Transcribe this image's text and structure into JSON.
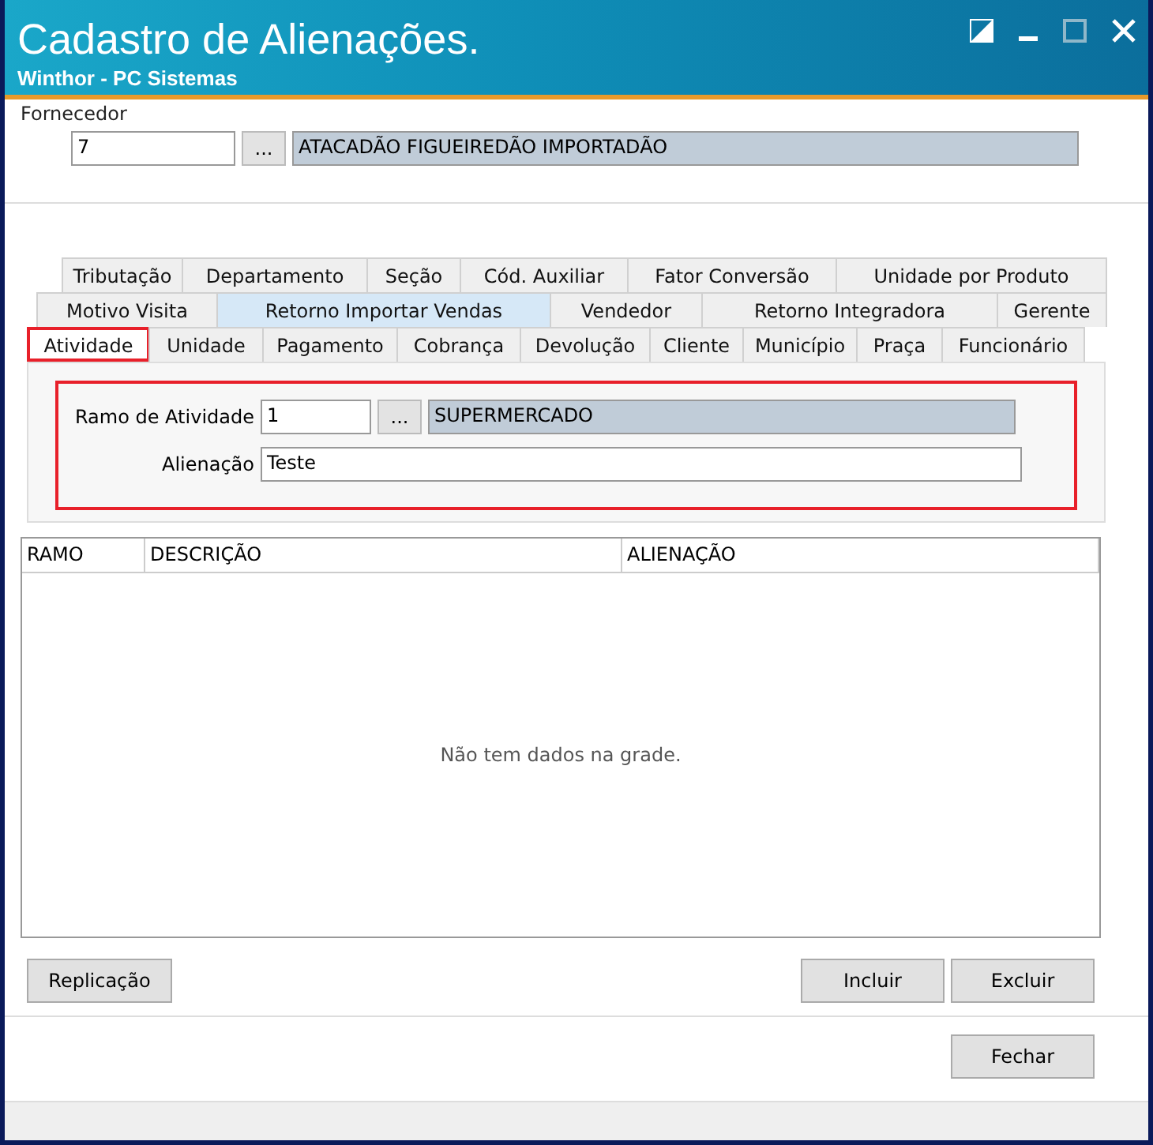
{
  "window": {
    "title": "Cadastro de Alienações.",
    "subtitle": "Winthor - PC Sistemas"
  },
  "fornecedor": {
    "legend": "Fornecedor",
    "code": "7",
    "lookup": "...",
    "name": "ATACADÃO FIGUEIREDÃO IMPORTADÃO"
  },
  "tab_rows": [
    [
      {
        "label": "Tributação",
        "selected": false,
        "highlighted": false,
        "outlined": false
      },
      {
        "label": "Departamento",
        "selected": false,
        "highlighted": false,
        "outlined": false
      },
      {
        "label": "Seção",
        "selected": false,
        "highlighted": false,
        "outlined": false
      },
      {
        "label": "Cód. Auxiliar",
        "selected": false,
        "highlighted": false,
        "outlined": false
      },
      {
        "label": "Fator Conversão",
        "selected": false,
        "highlighted": false,
        "outlined": false
      },
      {
        "label": "Unidade por Produto",
        "selected": false,
        "highlighted": false,
        "outlined": false
      }
    ],
    [
      {
        "label": "Motivo Visita",
        "selected": false,
        "highlighted": false,
        "outlined": false
      },
      {
        "label": "Retorno Importar Vendas",
        "selected": false,
        "highlighted": true,
        "outlined": false
      },
      {
        "label": "Vendedor",
        "selected": false,
        "highlighted": false,
        "outlined": false
      },
      {
        "label": "Retorno Integradora",
        "selected": false,
        "highlighted": false,
        "outlined": false
      },
      {
        "label": "Gerente",
        "selected": false,
        "highlighted": false,
        "outlined": false
      }
    ],
    [
      {
        "label": "Atividade",
        "selected": true,
        "highlighted": false,
        "outlined": true
      },
      {
        "label": "Unidade",
        "selected": false,
        "highlighted": false,
        "outlined": false
      },
      {
        "label": "Pagamento",
        "selected": false,
        "highlighted": false,
        "outlined": false
      },
      {
        "label": "Cobrança",
        "selected": false,
        "highlighted": false,
        "outlined": false
      },
      {
        "label": "Devolução",
        "selected": false,
        "highlighted": false,
        "outlined": false
      },
      {
        "label": "Cliente",
        "selected": false,
        "highlighted": false,
        "outlined": false
      },
      {
        "label": "Município",
        "selected": false,
        "highlighted": false,
        "outlined": false
      },
      {
        "label": "Praça",
        "selected": false,
        "highlighted": false,
        "outlined": false
      },
      {
        "label": "Funcionário",
        "selected": false,
        "highlighted": false,
        "outlined": false
      }
    ]
  ],
  "form": {
    "outlined": true,
    "ramo_label": "Ramo de Atividade",
    "ramo_code": "1",
    "lookup": "...",
    "ramo_name": "SUPERMERCADO",
    "alienacao_label": "Alienação",
    "alienacao_value": "Teste"
  },
  "table": {
    "columns": [
      "RAMO",
      "DESCRIÇÃO",
      "ALIENAÇÃO"
    ],
    "empty_message": "Não tem dados na grade."
  },
  "buttons": {
    "left": [
      "Replicação"
    ],
    "right": [
      "Incluir",
      "Excluir"
    ],
    "footer": [
      "Fechar"
    ]
  }
}
